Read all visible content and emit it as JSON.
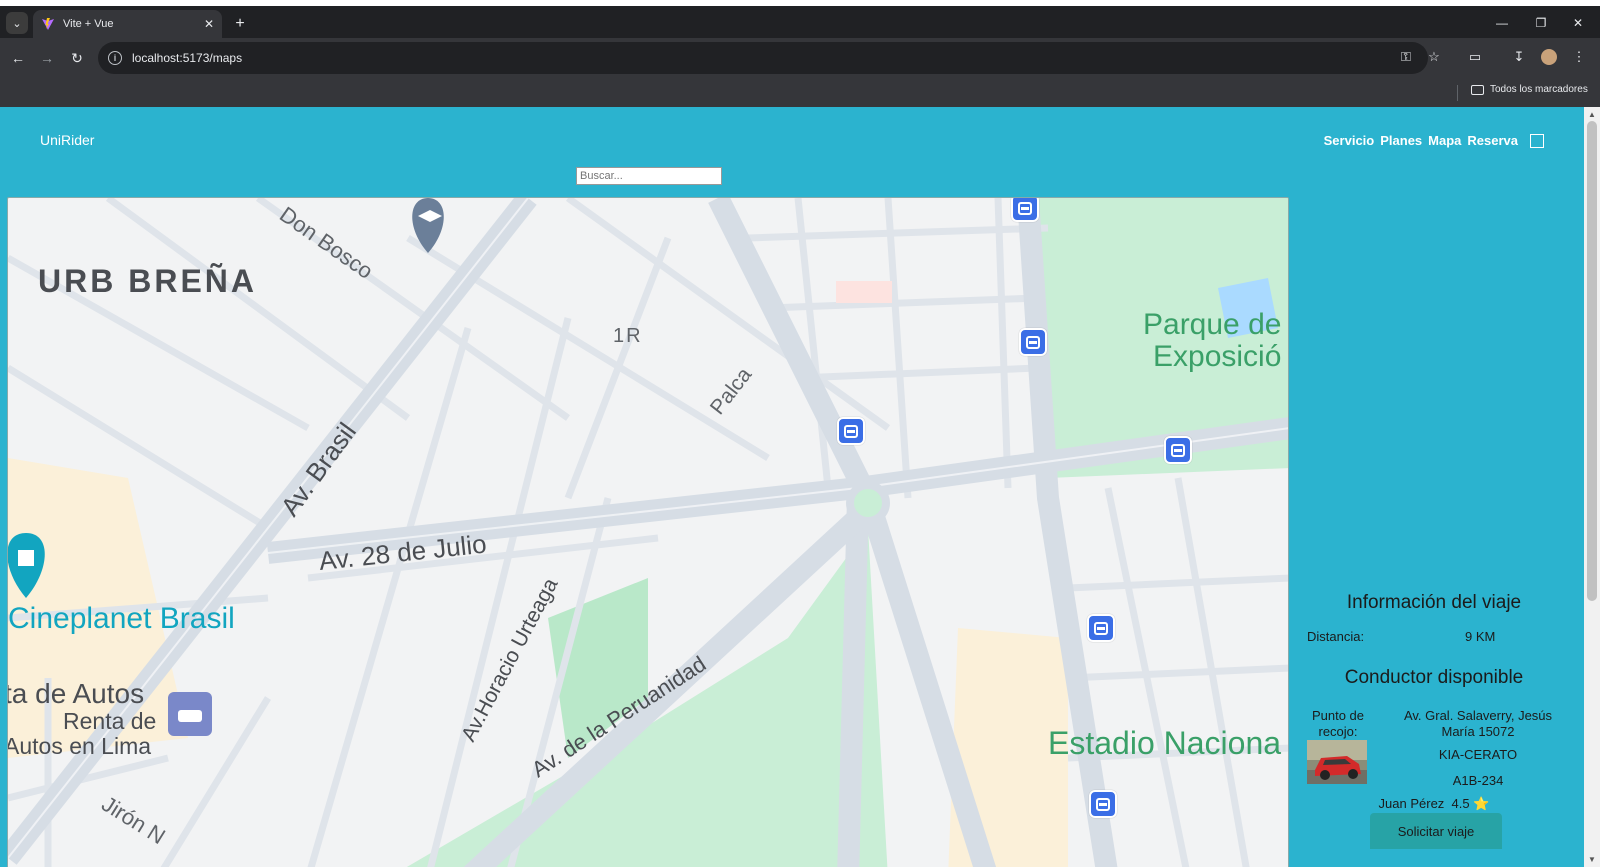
{
  "browser": {
    "tab_title": "Vite + Vue",
    "url": "localhost:5173/maps",
    "bookmarks_label": "Todos los marcadores"
  },
  "app": {
    "brand": "UniRider",
    "nav": [
      "Servicio",
      "Planes",
      "Mapa",
      "Reserva"
    ],
    "search_placeholder": "Buscar..."
  },
  "map": {
    "labels": {
      "urb": "URB BREÑA",
      "don_bosco": "Don Bosco",
      "r1": "1R",
      "palca": "Palca",
      "av_brasil": "Av. Brasil",
      "av_28": "Av. 28 de Julio",
      "urteaga": "Av.Horacio Urteaga",
      "peruanidad": "Av. de la Peruanidad",
      "parque1": "Parque de",
      "parque2": "Exposició",
      "cine": "Cineplanet Brasil",
      "renta1": "ta de Autos",
      "renta2": "Renta de",
      "renta3": "Autos en Lima",
      "estadio": "Estadio Naciona",
      "jiron": "Jirón N"
    }
  },
  "trip": {
    "title": "Información del viaje",
    "distance_label": "Distancia:",
    "distance_value": "9 KM",
    "driver_title": "Conductor disponible",
    "pickup_label": "Punto de recojo:",
    "pickup_value": "Av. Gral. Salaverry, Jesús María 15072",
    "car_model": "KIA-CERATO",
    "plate": "A1B-234",
    "driver_name": "Juan Pérez",
    "rating": "4.5",
    "star": "⭐",
    "request_button": "Solicitar viaje"
  },
  "colors": {
    "app_bg": "#2bb3cf",
    "button_bg": "#27a3a6",
    "bus_icon": "#3b6ee6",
    "park": "#c9eed6"
  }
}
